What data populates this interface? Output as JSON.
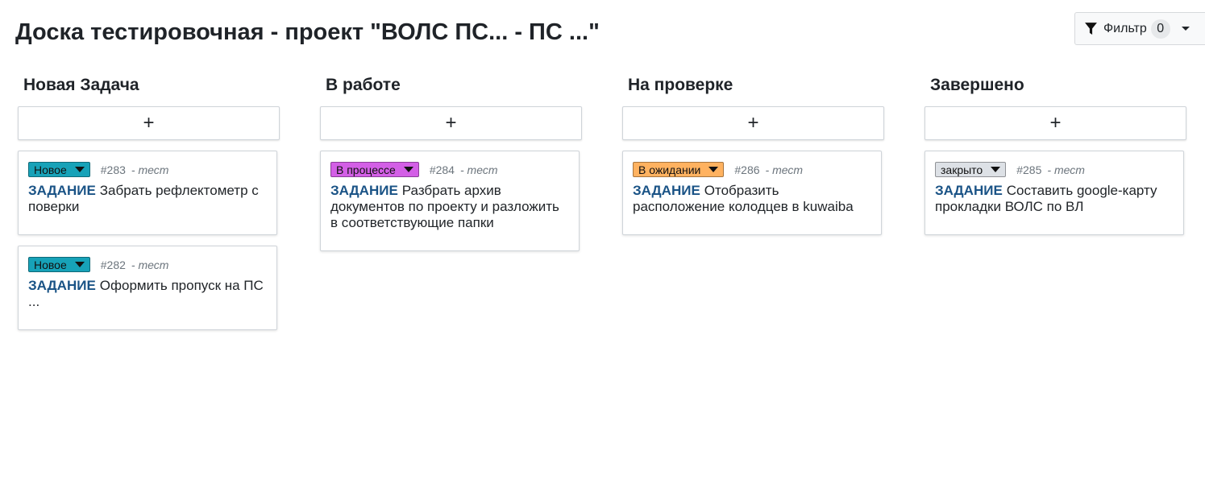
{
  "page": {
    "title": "Доска тестировочная - проект \"ВОЛС ПС... - ПС ...\""
  },
  "filter": {
    "label": "Фильтр",
    "count": "0"
  },
  "colors": {
    "new": "#17a2b8",
    "in_progress": "#d35fe6",
    "waiting": "#ffb260",
    "closed": "#dde1e6",
    "task_type": "#1a5386"
  },
  "add_label": "+",
  "columns": [
    {
      "title": "Новая Задача",
      "cards": [
        {
          "status": "Новое",
          "id": "#283",
          "author": "- тест",
          "type": "ЗАДАНИЕ",
          "text": "Забрать рефлектометр с поверки"
        },
        {
          "status": "Новое",
          "id": "#282",
          "author": "- тест",
          "type": "ЗАДАНИЕ",
          "text": "Оформить пропуск на ПС ..."
        }
      ]
    },
    {
      "title": "В работе",
      "cards": [
        {
          "status": "В процессе",
          "id": "#284",
          "author": "- тест",
          "type": "ЗАДАНИЕ",
          "text": "Разбрать архив документов по проекту и разложить в соответствующие папки"
        }
      ]
    },
    {
      "title": "На проверке",
      "cards": [
        {
          "status": "В ожидании",
          "id": "#286",
          "author": "- тест",
          "type": "ЗАДАНИЕ",
          "text": "Отобразить расположение колодцев в kuwaiba"
        }
      ]
    },
    {
      "title": "Завершено",
      "cards": [
        {
          "status": "закрыто",
          "id": "#285",
          "author": "- тест",
          "type": "ЗАДАНИЕ",
          "text": "Составить google-карту прокладки ВОЛС по ВЛ"
        }
      ]
    }
  ]
}
